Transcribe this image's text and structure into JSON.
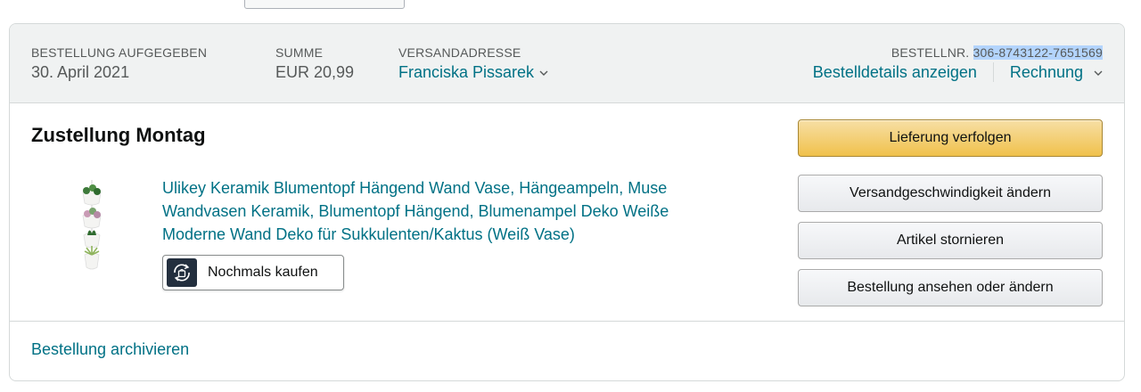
{
  "order": {
    "placed_label": "BESTELLUNG AUFGEGEBEN",
    "placed_value": "30. April 2021",
    "total_label": "SUMME",
    "total_value": "EUR 20,99",
    "ship_to_label": "VERSANDADRESSE",
    "ship_to_value": "Franciska Pissarek",
    "order_number_label": "BESTELLNR.",
    "order_number_value": "306-8743122-7651569",
    "details_link": "Bestelldetails anzeigen",
    "invoice_link": "Rechnung"
  },
  "shipment": {
    "status": "Zustellung Montag",
    "product_title": "Ulikey Keramik Blumentopf Hängend Wand Vase, Hängeampeln, Muse Wandvasen Keramik, Blumentopf Hängend, Blumenampel Deko Weiße Moderne Wand Deko für Sukkulenten/Kaktus (Weiß Vase)",
    "buy_again_label": "Nochmals kaufen"
  },
  "actions": {
    "track": "Lieferung verfolgen",
    "change_speed": "Versandgeschwindigkeit ändern",
    "cancel": "Artikel stornieren",
    "view_edit": "Bestellung ansehen oder ändern"
  },
  "footer": {
    "archive": "Bestellung archivieren"
  },
  "colors": {
    "link": "#007185",
    "header_bg": "#f0f2f2",
    "primary_button": "#f0c14b",
    "selection_highlight": "#b3d4fc"
  },
  "icons": {
    "ship_to_caret": "chevron-down-icon",
    "invoice_caret": "chevron-down-icon",
    "buy_again": "buy-again-icon"
  }
}
